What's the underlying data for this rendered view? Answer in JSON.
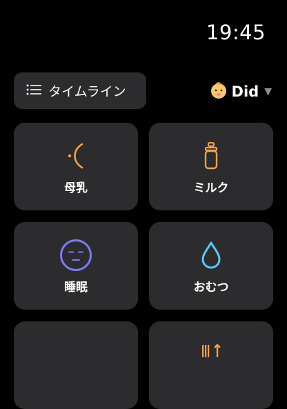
{
  "status_bar": {
    "time": "19:45"
  },
  "header": {
    "timeline_label": "タイムライン",
    "profile_name": "Did",
    "caret": "▼"
  },
  "tiles": [
    {
      "label": "母乳",
      "icon": "breastfeeding-icon",
      "color": "#f5a04a"
    },
    {
      "label": "ミルク",
      "icon": "bottle-icon",
      "color": "#f5a04a"
    },
    {
      "label": "睡眠",
      "icon": "sleep-face-icon",
      "color": "#7b7cf5"
    },
    {
      "label": "おむつ",
      "icon": "drop-icon",
      "color": "#5ac8fa"
    },
    {
      "label": "",
      "icon": "",
      "color": "#2c2c2e"
    },
    {
      "label": "",
      "icon": "meal-icon",
      "color": "#f5a04a"
    }
  ],
  "colors": {
    "background": "#000000",
    "tile": "#2c2c2e",
    "accent_orange": "#f5a04a",
    "accent_purple": "#7b7cf5",
    "accent_blue": "#5ac8fa"
  }
}
